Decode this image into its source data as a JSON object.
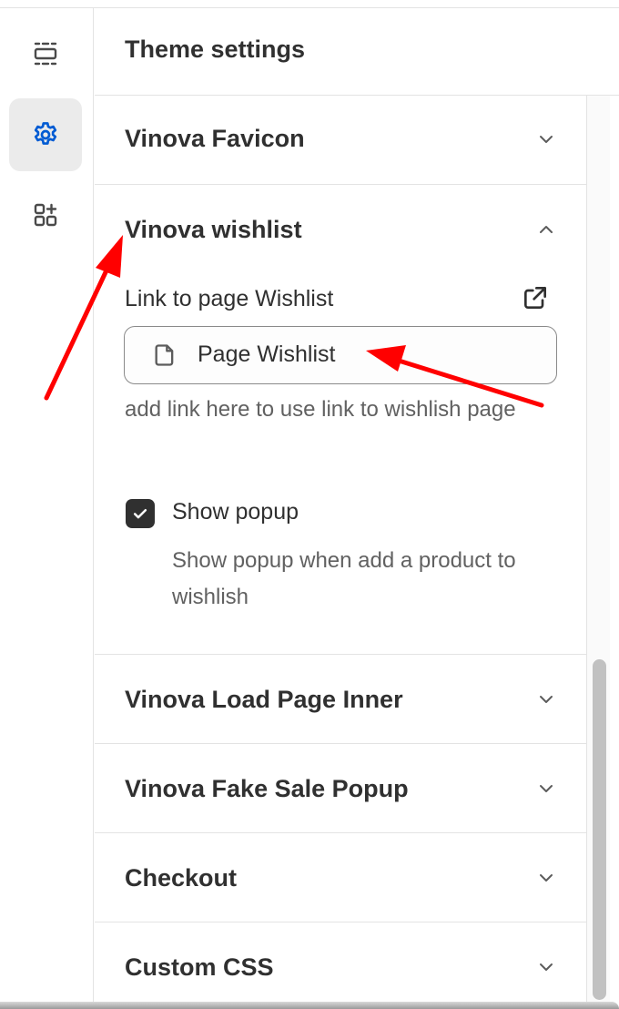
{
  "rail": {
    "items": [
      {
        "icon": "sections-icon",
        "active": false
      },
      {
        "icon": "gear-icon",
        "active": true
      },
      {
        "icon": "add-block-icon",
        "active": false
      }
    ]
  },
  "panel": {
    "title": "Theme settings",
    "sections": [
      {
        "title": "Vinova Favicon",
        "expanded": false
      },
      {
        "title": "Vinova wishlist",
        "expanded": true,
        "field_label": "Link to page Wishlist",
        "picker_value": "Page Wishlist",
        "help_text": "add link here to use link to wishlish page",
        "checkbox_label": "Show popup",
        "checkbox_checked": true,
        "checkbox_help": "Show popup when add a product to wishlish"
      },
      {
        "title": "Vinova Load Page Inner",
        "expanded": false
      },
      {
        "title": "Vinova Fake Sale Popup",
        "expanded": false
      },
      {
        "title": "Checkout",
        "expanded": false
      },
      {
        "title": "Custom CSS",
        "expanded": false
      }
    ]
  },
  "colors": {
    "accent": "#005bd3",
    "text": "#303030",
    "muted": "#616161",
    "annotation_arrow": "#ff0000"
  }
}
